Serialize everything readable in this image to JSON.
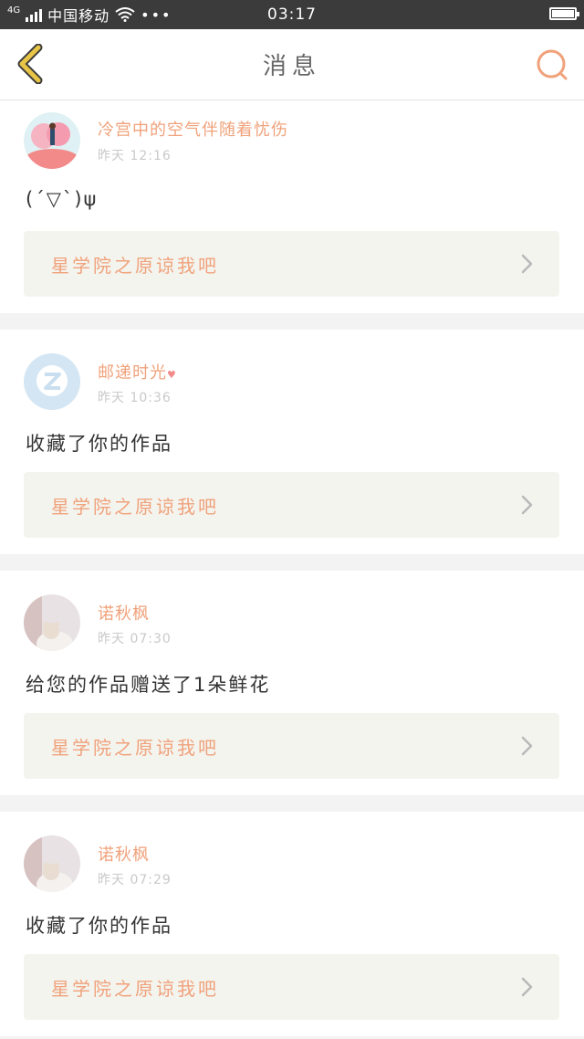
{
  "status_bar": {
    "network": "4G",
    "carrier": "中国移动",
    "more": "•••",
    "time": "03:17"
  },
  "header": {
    "title": "消息",
    "back_icon": "chevron-left-icon",
    "search_icon": "search-icon"
  },
  "colors": {
    "accent": "#f0a27b",
    "back": "#e8c547",
    "link_bg": "#f4f4ef"
  },
  "messages": [
    {
      "username": "冷宫中的空气伴随着忧伤",
      "time": "昨天 12:16",
      "content": "(´▽`)ψ",
      "work_title": "星学院之原谅我吧"
    },
    {
      "username": "邮递时光",
      "time": "昨天 10:36",
      "content": "收藏了你的作品",
      "work_title": "星学院之原谅我吧"
    },
    {
      "username": "诺秋枫",
      "time": "昨天 07:30",
      "content": "给您的作品赠送了1朵鲜花",
      "work_title": "星学院之原谅我吧"
    },
    {
      "username": "诺秋枫",
      "time": "昨天 07:29",
      "content": "收藏了你的作品",
      "work_title": "星学院之原谅我吧"
    }
  ]
}
